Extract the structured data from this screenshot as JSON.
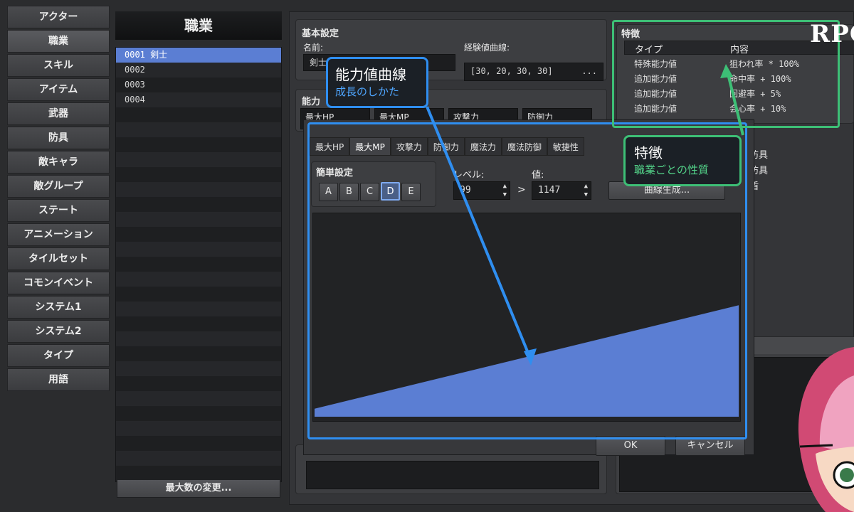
{
  "nav": {
    "items": [
      "アクター",
      "職業",
      "スキル",
      "アイテム",
      "武器",
      "防具",
      "敵キャラ",
      "敵グループ",
      "ステート",
      "アニメーション",
      "タイルセット",
      "コモンイベント",
      "システム1",
      "システム2",
      "タイプ",
      "用語"
    ],
    "active_index": 1
  },
  "class_panel": {
    "title": "職業",
    "rows": [
      "0001 剣士",
      "0002",
      "0003",
      "0004"
    ],
    "selected_index": 0,
    "max_button": "最大数の変更..."
  },
  "basic": {
    "title": "基本設定",
    "name_label": "名前:",
    "name_value": "剣士",
    "exp_label": "経験値曲線:",
    "exp_value": "[30, 20, 30, 30]",
    "exp_button": "..."
  },
  "params": {
    "title": "能力",
    "boxes": [
      "最大HP",
      "最大MP",
      "攻撃力",
      "防御力"
    ]
  },
  "traits": {
    "title": "特徴",
    "col_type": "タイプ",
    "col_content": "内容",
    "rows": [
      {
        "type": "特殊能力値",
        "content": "狙われ率 * 100%"
      },
      {
        "type": "追加能力値",
        "content": "命中率 + 100%"
      },
      {
        "type": "追加能力値",
        "content": "回避率 + 5%"
      },
      {
        "type": "追加能力値",
        "content": "会心率 + 10%"
      }
    ],
    "behind": [
      "防具",
      "防具",
      "盾"
    ]
  },
  "dialog": {
    "tabs": [
      "最大HP",
      "最大MP",
      "攻撃力",
      "防御力",
      "魔法力",
      "魔法防御",
      "敏捷性"
    ],
    "active_tab": 1,
    "simple_title": "簡単設定",
    "letters": [
      "A",
      "B",
      "C",
      "D",
      "E"
    ],
    "selected_letter": 3,
    "level_label": "レベル:",
    "level_value": "99",
    "arrow": ">",
    "value_label": "値:",
    "value_value": "1147",
    "generate_button": "曲線生成...",
    "ok": "OK",
    "cancel": "キャンセル",
    "curve_color": "#5b7ed3"
  },
  "chart_data": {
    "type": "area",
    "x": [
      1,
      99
    ],
    "values": [
      0.04,
      0.56
    ],
    "description_units": "fraction of graph height"
  },
  "annotations": {
    "curve_main": "能力値曲線",
    "curve_sub": "成長のしかた",
    "trait_main": "特徴",
    "trait_sub": "職業ごとの性質",
    "blue": "#2f8ef0",
    "green": "#3dbf76"
  },
  "logo": "RPG"
}
